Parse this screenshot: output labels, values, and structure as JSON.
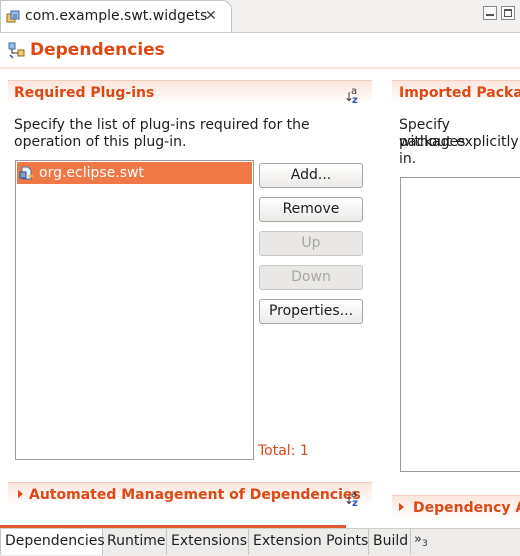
{
  "editor": {
    "tab_title": "com.example.swt.widgets",
    "close_glyph": "✕",
    "form_title": "Dependencies"
  },
  "required": {
    "title": "Required Plug-ins",
    "description_line1": "Specify the list of plug-ins required for the",
    "description_line2": "operation of this plug-in.",
    "items": [
      {
        "label": "org.eclipse.swt",
        "selected": true
      }
    ],
    "buttons": {
      "add": "Add...",
      "remove": "Remove",
      "up": "Up",
      "down": "Down",
      "properties": "Properties..."
    },
    "total": "Total: 1"
  },
  "imported": {
    "title": "Imported Packag",
    "description_line1": "Specify packages",
    "description_line2": "without explicitly",
    "description_line3": "in."
  },
  "automated": {
    "title": "Automated Management of Dependencies"
  },
  "dependency_analysis": {
    "title": "Dependency A"
  },
  "bottom_tabs": [
    {
      "label": "Dependencies",
      "active": true
    },
    {
      "label": "Runtime",
      "active": false
    },
    {
      "label": "Extensions",
      "active": false
    },
    {
      "label": "Extension Points",
      "active": false
    },
    {
      "label": "Build",
      "active": false
    }
  ],
  "overflow": {
    "chevron": "»",
    "count": "3"
  },
  "icons": {
    "editor_tab": "plugin-manifest-icon",
    "form_header": "plugin-dependencies-icon",
    "list_item": "plugin-icon",
    "sort": "sort-alphabetically-icon"
  },
  "colors": {
    "accent": "#dd4814",
    "selection": "#f07746",
    "section_bg": "#fbe6dd"
  }
}
